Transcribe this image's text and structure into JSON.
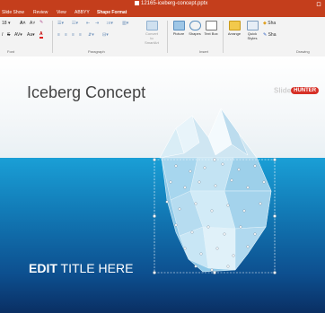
{
  "titlebar": {
    "filename": "12165-iceberg-concept.pptx",
    "window_glyph": "ロ"
  },
  "tabs": [
    {
      "label": "Slide Show"
    },
    {
      "label": "Review"
    },
    {
      "label": "View"
    },
    {
      "label": "ABBYY"
    },
    {
      "label": "Shape Format"
    }
  ],
  "ribbon": {
    "font_size": "18",
    "groups": {
      "font": "Font",
      "paragraph": "Paragraph",
      "insert": "Insert",
      "drawing": "Drawing"
    },
    "buttons": {
      "convert": "Convert to SmartArt",
      "picture": "Picture",
      "shapes": "Shapes",
      "textbox": "Text Box",
      "arrange": "Arrange",
      "quick_styles": "Quick Styles",
      "shape_fill": "Sha",
      "shape_outline": "Sha"
    }
  },
  "slide": {
    "title": "Iceberg Concept",
    "edit_bold": "EDIT",
    "edit_rest": " TITLE HERE",
    "logo_left": "Slide",
    "logo_right": "HUNTER"
  },
  "colors": {
    "ribbon_accent": "#c43e1c",
    "sea_top": "#1a9fd6",
    "sea_bottom": "#0a2f63",
    "logo_red": "#d63027"
  }
}
